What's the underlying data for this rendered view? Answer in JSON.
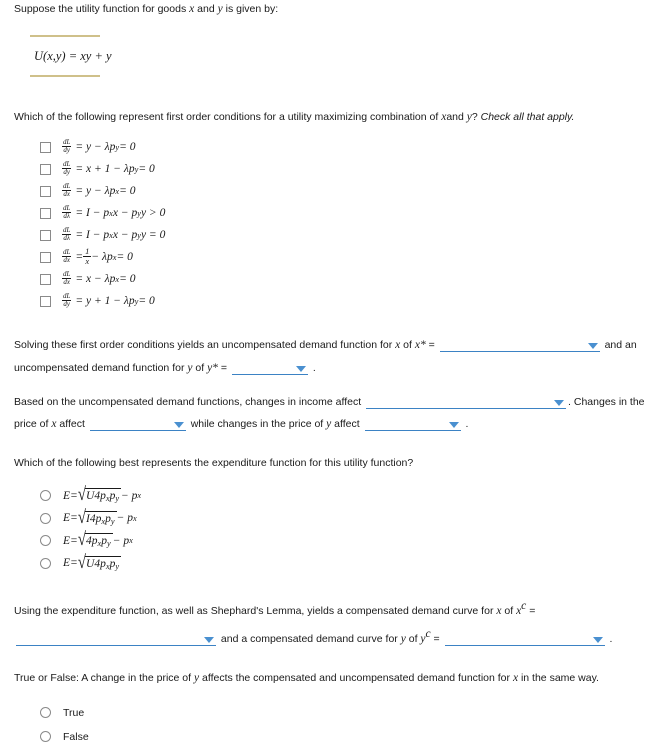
{
  "intro": {
    "line": "Suppose the utility function for goods x and y is given by:",
    "pre_x": "Suppose the utility function for goods ",
    "x": "x",
    "mid": " and ",
    "y": "y",
    "post": " is given by:"
  },
  "utility_formula": {
    "lhs": "U(x,y)",
    "eq": "=",
    "rhs": "xy + y",
    "full": "U(x,y) = xy + y"
  },
  "foc_question": {
    "text_before": "Which of the following represent first order conditions for a utility maximizing combination of ",
    "var1": "x",
    "text_mid": "and ",
    "var2": "y",
    "text_after": "? ",
    "emphasis": "Check all that apply."
  },
  "foc_options": [
    {
      "den": "dy",
      "rhs": "= y − λp",
      "sub": "y",
      "tail": " = 0",
      "form": "plain"
    },
    {
      "den": "dy",
      "rhs": "= x + 1 − λp",
      "sub": "y",
      "tail": " = 0",
      "form": "plain"
    },
    {
      "den": "dx",
      "rhs": "= y − λp",
      "sub": "x",
      "tail": " = 0",
      "form": "plain"
    },
    {
      "den": "dλ",
      "rhs": "= I − p",
      "sub": "x",
      "tail": "x − p",
      "sub2": "y",
      "tail2": "y > 0",
      "form": "budget"
    },
    {
      "den": "dλ",
      "rhs": "= I − p",
      "sub": "x",
      "tail": "x − p",
      "sub2": "y",
      "tail2": "y = 0",
      "form": "budget"
    },
    {
      "den": "dx",
      "rhs": "= ",
      "frac_num": "1",
      "frac_den": "x",
      "tail": " − λp",
      "sub": "x",
      "tail2": " = 0",
      "form": "invfrac"
    },
    {
      "den": "dx",
      "rhs": "= x − λp",
      "sub": "x",
      "tail": " = 0",
      "form": "plain"
    },
    {
      "den": "dy",
      "rhs": "= y + 1 − λp",
      "sub": "y",
      "tail": " = 0",
      "form": "plain"
    }
  ],
  "foc_numerator": "dL",
  "demand_paragraph": {
    "seg1": "Solving these first order conditions yields an uncompensated demand function for ",
    "var_x": "x",
    "seg2": " of ",
    "xstar": "x*",
    "eq1": " = ",
    "seg3": " and an uncompensated demand function for ",
    "var_y": "y",
    "seg4": " of ",
    "ystar": "y*",
    "eq2": " = ",
    "period": " ."
  },
  "income_paragraph": {
    "seg1": "Based on the uncompensated demand functions, changes in income affect ",
    "seg2": ". Changes in the price of ",
    "var_x": "x",
    "seg3": " affect ",
    "seg4": " while changes in the price of ",
    "var_y": "y",
    "seg5": " affect ",
    "period": " ."
  },
  "expenditure_question": "Which of the following best represents the expenditure function for this utility function?",
  "expenditure_options": [
    {
      "lhs": "E",
      "eq": " = ",
      "radicand_lead": "U",
      "radicand": "4p",
      "sub1": "x",
      "mid": "p",
      "sub2": "y",
      "suffix": " − p",
      "suffix_sub": "x"
    },
    {
      "lhs": "E",
      "eq": " = ",
      "radicand_lead": "I",
      "radicand": "4p",
      "sub1": "x",
      "mid": "p",
      "sub2": "y",
      "suffix": " − p",
      "suffix_sub": "x"
    },
    {
      "lhs": "E",
      "eq": " = ",
      "radicand_lead": "",
      "radicand": "4p",
      "sub1": "x",
      "mid": "p",
      "sub2": "y",
      "suffix": " − p",
      "suffix_sub": "x"
    },
    {
      "lhs": "E",
      "eq": " = ",
      "radicand_lead": "U",
      "radicand": "4p",
      "sub1": "x",
      "mid": "p",
      "sub2": "y",
      "suffix": "",
      "suffix_sub": ""
    }
  ],
  "shephard_paragraph": {
    "seg1": "Using the expenditure function, as well as Shephard's Lemma, yields a compensated demand curve for ",
    "var_x": "x",
    "seg2": " of ",
    "xc": "x",
    "xc_sup": "c",
    "eq1": " = ",
    "seg3": " and a compensated demand curve for ",
    "var_y": "y",
    "seg4": " of ",
    "yc": "y",
    "yc_sup": "c",
    "eq2": " = ",
    "period": " ."
  },
  "true_false_question": {
    "seg1": "True or False: A change in the price of ",
    "var_y": "y",
    "seg2": " affects the compensated and uncompensated demand function for ",
    "var_x": "x",
    "seg3": " in the same way."
  },
  "true_false_options": [
    {
      "label": "True"
    },
    {
      "label": "False"
    }
  ],
  "colors": {
    "rule": "#cfc08a",
    "dropdown_line": "#3b82c4",
    "dropdown_caret": "#4a90d0",
    "text": "#1a1a1a",
    "control_border": "#8a8a8a"
  }
}
